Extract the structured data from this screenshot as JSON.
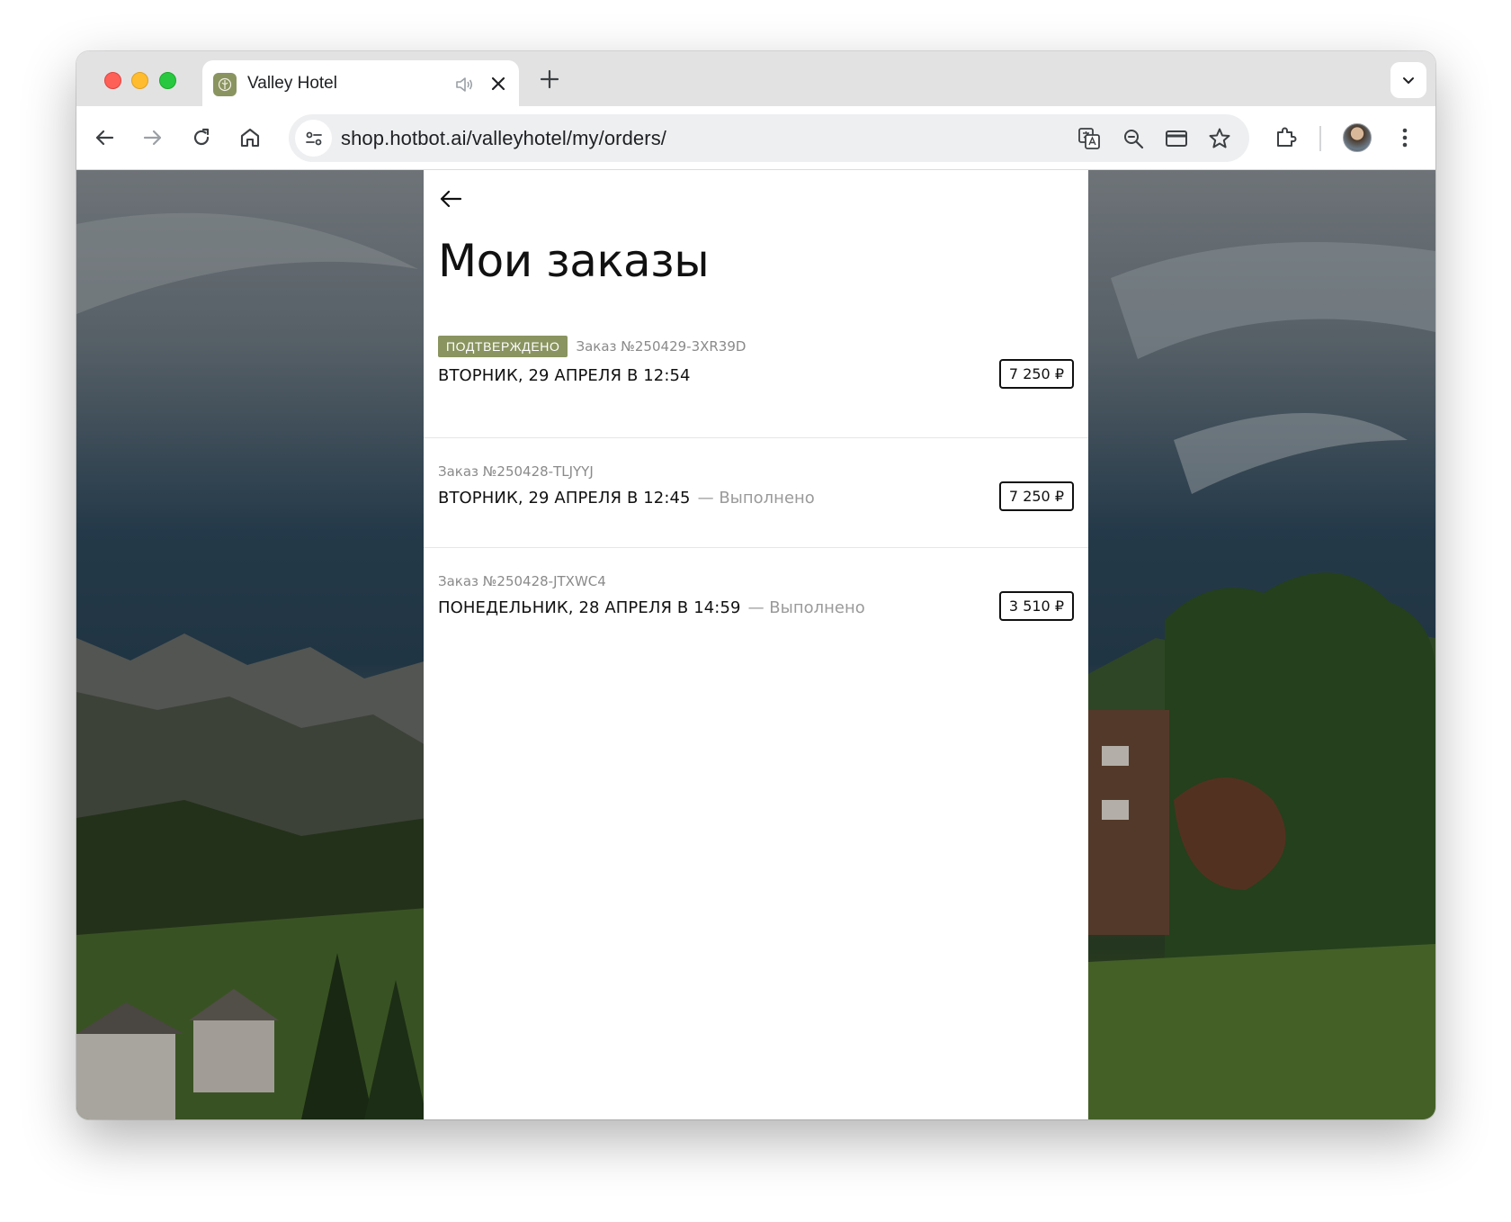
{
  "browser": {
    "tab": {
      "title": "Valley Hotel"
    },
    "address_bar": {
      "url": "shop.hotbot.ai/valleyhotel/my/orders/"
    }
  },
  "page": {
    "title": "Мои заказы",
    "orders": [
      {
        "badge": "ПОДТВЕРЖДЕНО",
        "number": "Заказ №250429-3XR39D",
        "date": "ВТОРНИК, 29 АПРЕЛЯ В 12:54",
        "status": "",
        "price": "7 250 ₽"
      },
      {
        "badge": "",
        "number": "Заказ №250428-TLJYYJ",
        "date": "ВТОРНИК, 29 АПРЕЛЯ В 12:45",
        "status": "— Выполнено",
        "price": "7 250 ₽"
      },
      {
        "badge": "",
        "number": "Заказ №250428-JTXWC4",
        "date": "ПОНЕДЕЛЬНИК, 28 АПРЕЛЯ В 14:59",
        "status": "— Выполнено",
        "price": "3 510 ₽"
      }
    ]
  },
  "colors": {
    "accent": "#8a9460",
    "text": "#111111",
    "muted": "#9a9a9a"
  }
}
